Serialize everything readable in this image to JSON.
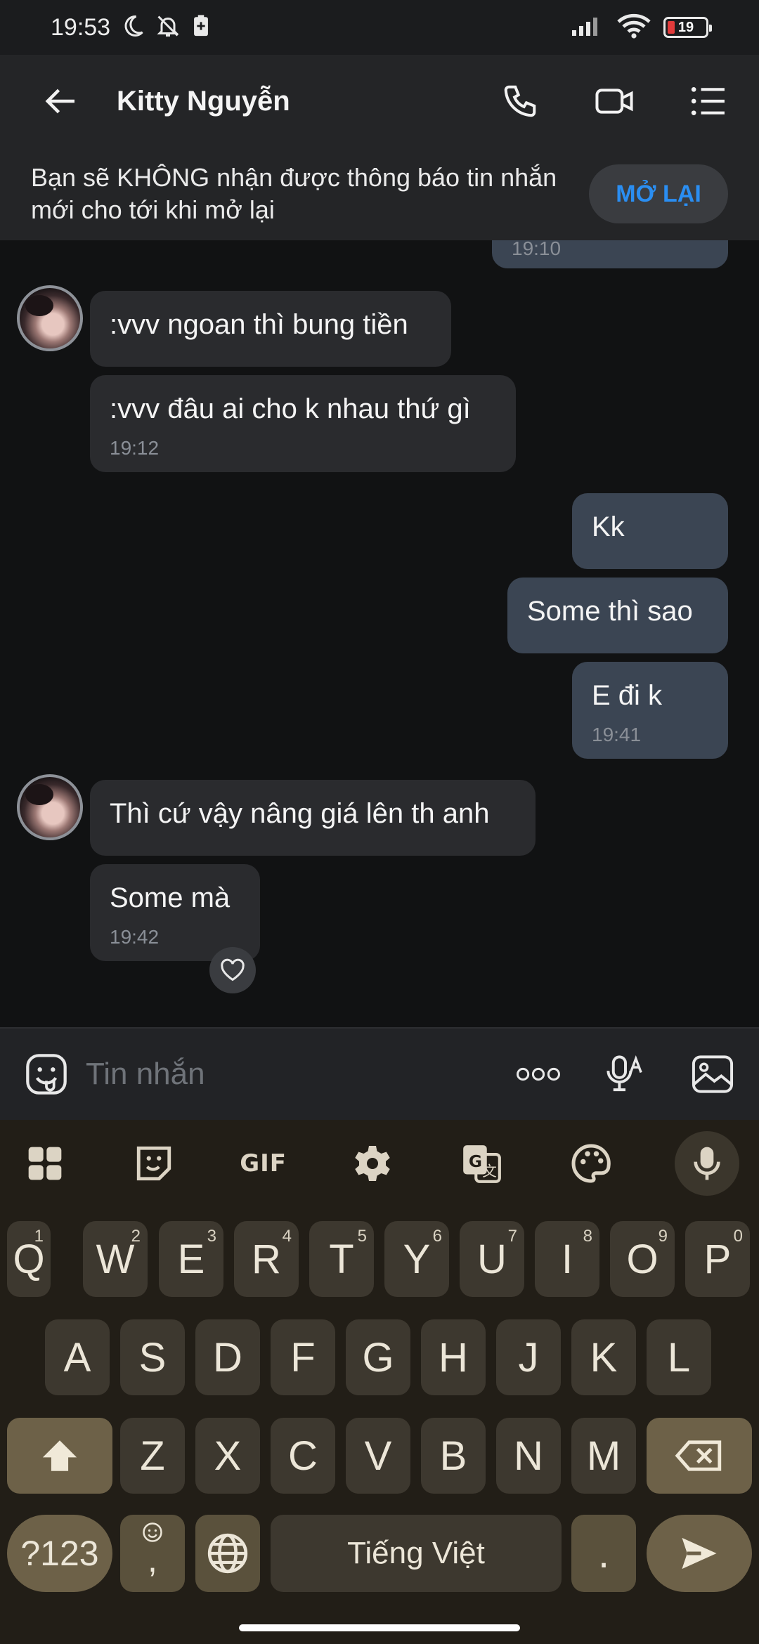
{
  "status_bar": {
    "time": "19:53",
    "battery": "19",
    "icons": [
      "moon-icon",
      "bell-off-icon",
      "battery-saver-icon",
      "signal-icon",
      "wifi-icon",
      "battery-icon"
    ]
  },
  "header": {
    "contact_name": "Kitty Nguyễn",
    "icons": [
      "back-arrow-icon",
      "phone-icon",
      "video-icon",
      "menu-list-icon"
    ]
  },
  "banner": {
    "text": "Bạn sẽ KHÔNG nhận được thông báo tin nhắn mới cho tới khi mở lại",
    "button_label": "MỞ LẠI"
  },
  "messages": [
    {
      "from": "me",
      "text": "",
      "time": "19:10"
    },
    {
      "from": "them",
      "text": ":vvv ngoan thì bung tiền",
      "time": ""
    },
    {
      "from": "them",
      "text": ":vvv đâu ai cho k nhau thứ gì",
      "time": "19:12"
    },
    {
      "from": "me",
      "text": "Kk",
      "time": ""
    },
    {
      "from": "me",
      "text": "Some thì sao",
      "time": ""
    },
    {
      "from": "me",
      "text": "E đi k",
      "time": "19:41"
    },
    {
      "from": "them",
      "text": "Thì cứ vậy nâng giá lên th anh",
      "time": ""
    },
    {
      "from": "them",
      "text": "Some mà",
      "time": "19:42"
    }
  ],
  "input": {
    "placeholder": "Tin nhắn",
    "icons": [
      "emoji-icon",
      "more-icon",
      "voice-text-icon",
      "image-icon"
    ]
  },
  "keyboard": {
    "toolbar_icons": [
      "apps-grid-icon",
      "sticker-icon",
      "gif-icon",
      "settings-icon",
      "translate-icon",
      "palette-icon",
      "mic-icon"
    ],
    "gif_label": "GIF",
    "row1": [
      {
        "label": "Q",
        "sup": "1"
      },
      {
        "label": "W",
        "sup": "2"
      },
      {
        "label": "E",
        "sup": "3"
      },
      {
        "label": "R",
        "sup": "4"
      },
      {
        "label": "T",
        "sup": "5"
      },
      {
        "label": "Y",
        "sup": "6"
      },
      {
        "label": "U",
        "sup": "7"
      },
      {
        "label": "I",
        "sup": "8"
      },
      {
        "label": "O",
        "sup": "9"
      },
      {
        "label": "P",
        "sup": "0"
      }
    ],
    "row2": [
      "A",
      "S",
      "D",
      "F",
      "G",
      "H",
      "J",
      "K",
      "L"
    ],
    "row3": [
      "Z",
      "X",
      "C",
      "V",
      "B",
      "N",
      "M"
    ],
    "symbols_label": "?123",
    "comma_label": ",",
    "space_label": "Tiếng Việt",
    "period_label": ".",
    "colors": {
      "keyboard_bg": "#221e17",
      "key": "#3d382f",
      "modifier": "#6d6148"
    }
  },
  "colors": {
    "accent": "#2a8ef2",
    "incoming_bubble": "#2a2b2e",
    "outgoing_bubble": "#3b4553"
  }
}
